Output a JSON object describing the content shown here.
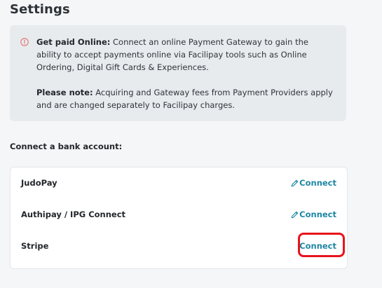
{
  "page": {
    "title": "Settings"
  },
  "notice": {
    "icon": "alert-circle-icon",
    "icon_color": "#e0736d",
    "p1_bold": "Get paid Online:",
    "p1_text": " Connect an online Payment Gateway to gain the ability to accept payments online via Facilipay tools such as Online Ordering, Digital Gift Cards & Experiences.",
    "p2_bold": "Please note:",
    "p2_text": " Acquiring and Gateway fees from Payment Providers apply and are changed separately to Facilipay charges."
  },
  "bank": {
    "label": "Connect a bank account:",
    "providers": [
      {
        "name": "JudoPay",
        "has_edit": true,
        "action": "Connect"
      },
      {
        "name": "Authipay / IPG Connect",
        "has_edit": true,
        "action": "Connect"
      },
      {
        "name": "Stripe",
        "has_edit": false,
        "action": "Connect"
      }
    ]
  },
  "colors": {
    "accent": "#1e86a5",
    "highlight": "#e8141c",
    "notice_bg": "#e8ebee"
  },
  "icons": {
    "edit": "pencil-icon"
  }
}
